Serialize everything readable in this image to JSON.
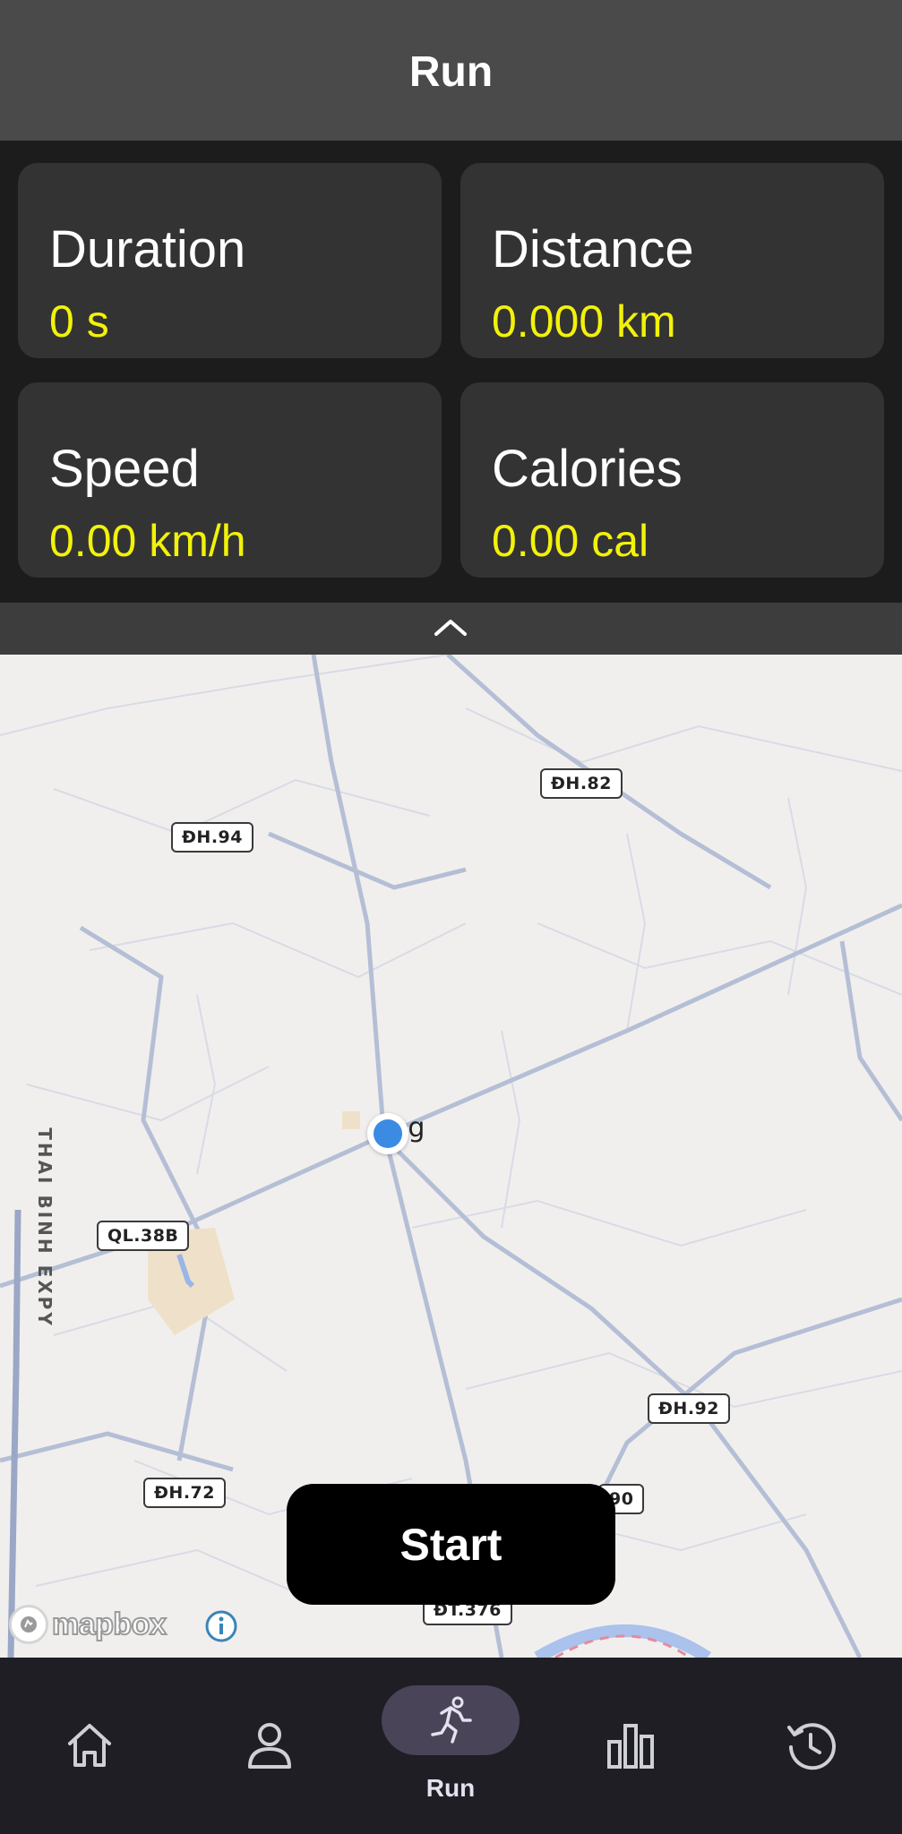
{
  "app_bar": {
    "title": "Run"
  },
  "stats": {
    "duration": {
      "label": "Duration",
      "value": "0 s"
    },
    "distance": {
      "label": "Distance",
      "value": "0.000 km"
    },
    "speed": {
      "label": "Speed",
      "value": "0.00 km/h"
    },
    "calories": {
      "label": "Calories",
      "value": "0.00 cal"
    }
  },
  "collapse_toggle": {
    "icon": "chevron-up-icon"
  },
  "map": {
    "road_labels": [
      "ĐH.94",
      "ĐH.82",
      "QL.38B",
      "ĐH.92",
      "ĐH.72",
      "90",
      "ĐT.376"
    ],
    "place_label": "ơng",
    "expressway_label": "THAI BINH EXPY",
    "attribution": "mapbox"
  },
  "start_button": {
    "label": "Start"
  },
  "bottom_nav": {
    "items": [
      {
        "icon": "home-icon"
      },
      {
        "icon": "person-icon"
      },
      {
        "icon": "running-icon",
        "label": "Run",
        "selected": true
      },
      {
        "icon": "bar-chart-icon"
      },
      {
        "icon": "history-icon"
      }
    ]
  },
  "colors": {
    "accent_value": "#f2f20a",
    "nav_selected_pill": "#4a4458",
    "location": "#3b8be3"
  }
}
